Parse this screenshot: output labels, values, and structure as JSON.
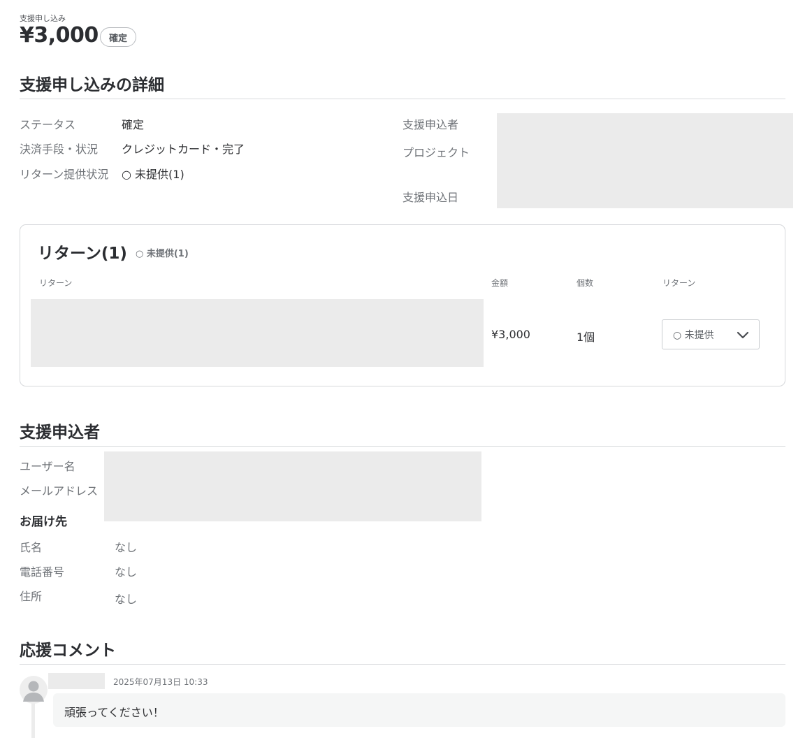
{
  "header": {
    "label": "支援申し込み",
    "amount": "¥3,000",
    "status_badge": "確定"
  },
  "details": {
    "title": "支援申し込みの詳細",
    "left": [
      {
        "label": "ステータス",
        "value": "確定"
      },
      {
        "label": "決済手段・状況",
        "value": "クレジットカード・完了"
      },
      {
        "label": "リターン提供状況",
        "value": "○ 未提供(1)"
      }
    ],
    "right_labels": [
      "支援申込者",
      "プロジェクト",
      "支援申込日"
    ]
  },
  "returns": {
    "title": "リターン(1)",
    "subtitle": "○ 未提供(1)",
    "columns": [
      "リターン",
      "金額",
      "個数",
      "リターン"
    ],
    "rows": [
      {
        "amount": "¥3,000",
        "quantity": "1個",
        "status_select": "○ 未提供"
      }
    ]
  },
  "applicant": {
    "title": "支援申込者",
    "fields": [
      {
        "label": "ユーザー名"
      },
      {
        "label": "メールアドレス"
      }
    ],
    "delivery_title": "お届け先",
    "delivery": [
      {
        "label": "氏名",
        "value": "なし"
      },
      {
        "label": "電話番号",
        "value": "なし"
      },
      {
        "label": "住所",
        "value": "なし"
      }
    ]
  },
  "comments": {
    "title": "応援コメント",
    "items": [
      {
        "timestamp": "2025年07月13日 10:33",
        "text": "頑張ってください！"
      }
    ]
  },
  "colors": {
    "redacted": "#ebebeb",
    "rule": "#d8dadd",
    "muted_text": "#6f7378"
  },
  "icons": {
    "select_chevron": "chevron-down-icon",
    "avatar": "user-avatar-icon"
  }
}
